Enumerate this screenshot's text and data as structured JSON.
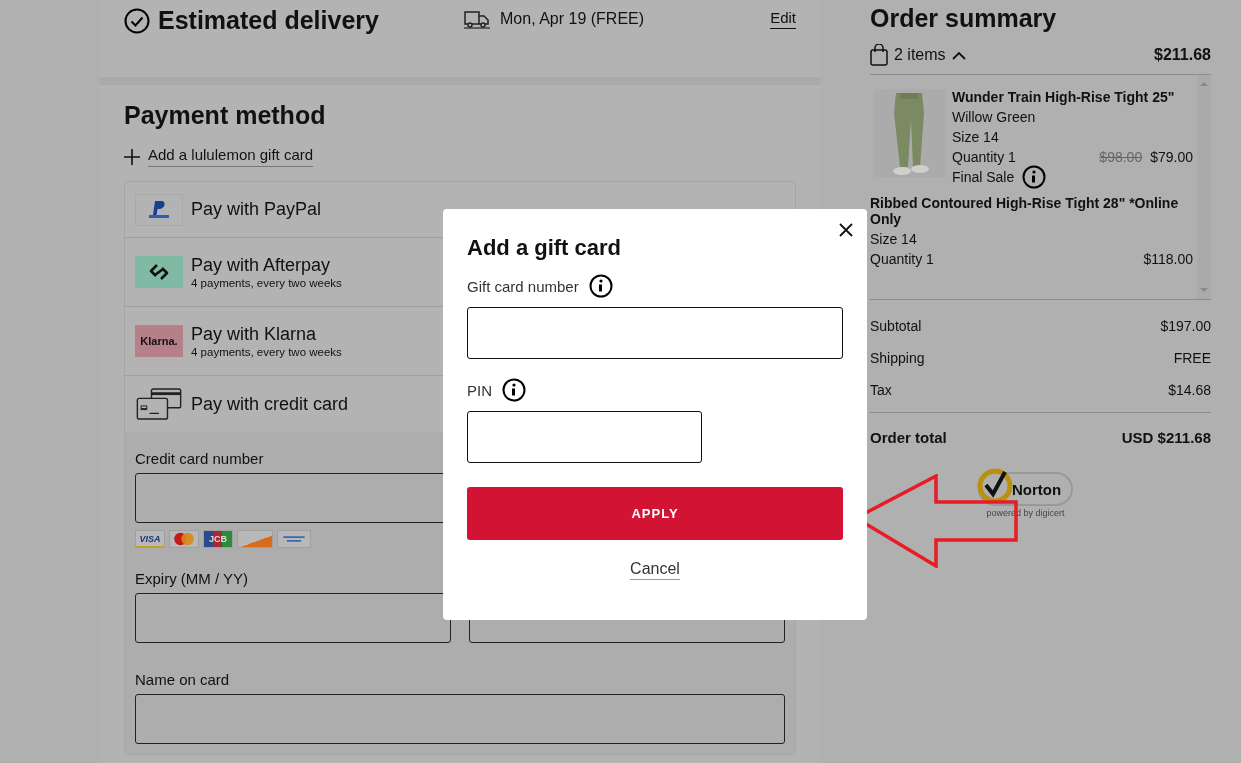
{
  "delivery": {
    "title": "Estimated delivery",
    "date": "Mon, Apr 19 (FREE)",
    "edit": "Edit"
  },
  "payment": {
    "title": "Payment method",
    "gift_card_link": "Add a lululemon gift card",
    "options": [
      {
        "kind": "paypal",
        "label": "Pay with PayPal"
      },
      {
        "kind": "afterpay",
        "label": "Pay with Afterpay",
        "note": "4 payments, every two weeks"
      },
      {
        "kind": "klarna",
        "label": "Pay with Klarna",
        "logo_text": "Klarna.",
        "note": "4 payments, every two weeks"
      },
      {
        "kind": "card",
        "label": "Pay with credit card"
      }
    ],
    "card_form": {
      "number_label": "Credit card number",
      "card_brands": [
        {
          "kind": "visa",
          "text": "VISA"
        },
        {
          "kind": "mastercard"
        },
        {
          "kind": "jcb",
          "text": "JCB"
        },
        {
          "kind": "discover"
        },
        {
          "kind": "amex"
        }
      ],
      "expiry_label": "Expiry (MM / YY)",
      "name_label": "Name on card"
    }
  },
  "summary": {
    "title": "Order summary",
    "count": "2 items",
    "expanded": true,
    "total": "$211.68",
    "items": [
      {
        "name": "Wunder Train High-Rise Tight 25\"",
        "variant": "Willow Green",
        "size": "Size 14",
        "quantity": "Quantity 1",
        "original_price": "$98.00",
        "price": "$79.00",
        "note": "Final Sale"
      },
      {
        "name": "Ribbed Contoured High-Rise Tight 28\" *Online Only",
        "size": "Size 14",
        "quantity": "Quantity 1",
        "price": "$118.00"
      }
    ],
    "totals": [
      {
        "label": "Subtotal",
        "value": "$197.00"
      },
      {
        "label": "Shipping",
        "value": "FREE"
      },
      {
        "label": "Tax",
        "value": "$14.68"
      }
    ],
    "order_total": {
      "label": "Order total",
      "value": "USD $211.68"
    },
    "badge": {
      "name": "Norton",
      "tagline": "powered by digicert"
    }
  },
  "dialog": {
    "title": "Add a gift card",
    "fields": [
      {
        "label": "Gift card number",
        "wide": true
      },
      {
        "label": "PIN",
        "wide": false
      }
    ],
    "apply": "APPLY",
    "cancel": "Cancel"
  }
}
